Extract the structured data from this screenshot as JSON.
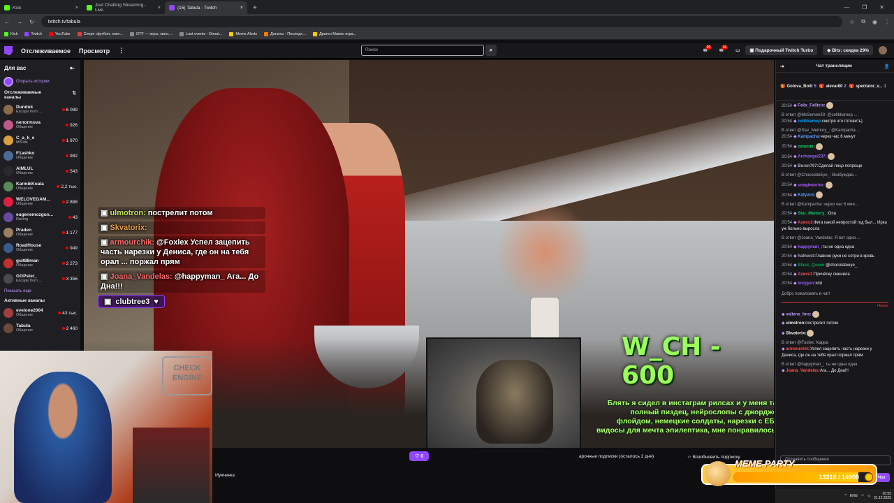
{
  "browser": {
    "tabs": [
      {
        "label": "Kick",
        "color": "#53fc18"
      },
      {
        "label": "Just Chatting Streaming - Live",
        "color": "#53fc18"
      },
      {
        "label": "(16) Tabula - Twitch",
        "color": "#9147ff"
      }
    ],
    "url": "twitch.tv/tabula",
    "bookmarks": [
      {
        "label": "Kick",
        "color": "#53fc18"
      },
      {
        "label": "Twitch",
        "color": "#9147ff"
      },
      {
        "label": "YouTube",
        "color": "#ff0000"
      },
      {
        "label": "Спорт: футбол, хоке...",
        "color": "#e04040"
      },
      {
        "label": "DTF — игры, кино,...",
        "color": "#888888"
      },
      {
        "label": "Last events - Donat...",
        "color": "#888888"
      },
      {
        "label": "Meme Alerts",
        "color": "#ffcc00"
      },
      {
        "label": "Донаты - Последн...",
        "color": "#ff7a00"
      },
      {
        "label": "Драгон Манис игра...",
        "color": "#ffcc00"
      }
    ]
  },
  "twitch": {
    "nav": {
      "following": "Отслеживаемое",
      "browse": "Просмотр",
      "search_placeholder": "Поиск",
      "notif_count": "29",
      "whisper_count": "16",
      "turbo": "Подарочный Twitch Turbo",
      "bits": "Bits: скидка 29%"
    },
    "sidebar": {
      "title": "Для вас",
      "stories": "Открыть истории",
      "followed_title": "Отслеживаемые каналы",
      "channels": [
        {
          "name": "Dunduk",
          "category": "Escape from ...",
          "viewers": "6 089",
          "color": "#8a6a4a"
        },
        {
          "name": "nenormova",
          "category": "Общение",
          "viewers": "926",
          "color": "#c05a8a"
        },
        {
          "name": "C_a_k_e",
          "category": "MiSide",
          "viewers": "1 870",
          "color": "#d8a040"
        },
        {
          "name": "F1ashko",
          "category": "Общение",
          "viewers": "982",
          "color": "#4a6a9a"
        },
        {
          "name": "AIMLUL",
          "category": "Общение",
          "viewers": "543",
          "color": "#2a2a2a"
        },
        {
          "name": "KarmikKoala",
          "category": "Общение",
          "viewers": "2,2 тыс.",
          "color": "#5a8a5a"
        },
        {
          "name": "WELOVEGAM...",
          "category": "Общение",
          "viewers": "2 888",
          "color": "#e02040"
        },
        {
          "name": "eugenemozgun...",
          "category": "Racing",
          "viewers": "43",
          "color": "#6a4aa0"
        },
        {
          "name": "Praden",
          "category": "Общение",
          "viewers": "1 177",
          "color": "#9a8060"
        },
        {
          "name": "RoadHouse",
          "category": "Общение",
          "viewers": "949",
          "color": "#3a5a8a"
        },
        {
          "name": "guit88man",
          "category": "Общение",
          "viewers": "2 273",
          "color": "#c03030"
        },
        {
          "name": "GOPster_",
          "category": "Escape from ...",
          "viewers": "3 356",
          "color": "#4a4a4a"
        }
      ],
      "show_more": "Показать еще",
      "active_title": "Активные каналы",
      "active": [
        {
          "name": "evelone2004",
          "category": "Общение",
          "viewers": "43 тыс.",
          "color": "#a04040"
        },
        {
          "name": "Tabula",
          "category": "Общение",
          "viewers": "2 460",
          "color": "#6a4a3a"
        }
      ]
    },
    "overlay_chat": [
      {
        "user": "ulmotron:",
        "text": "пострелит потом",
        "cls": "u-green"
      },
      {
        "user": "Skvatorix:",
        "text": "",
        "cls": "u-orange"
      },
      {
        "user": "armourchik:",
        "text": "@Foxlex Успел зацепить часть нарезки у Дениса, где он на тебя орал ... поржал прям",
        "cls": "u-red"
      },
      {
        "user": "Joana_Vandelas:",
        "text": "@happyman_ Ага... До Дна!!!",
        "cls": "u-red"
      }
    ],
    "club_label": "clubtree3",
    "wch_text": "W_CH - 600",
    "ticker": "Блять я сидел в инстаграм рилсах и у меня там полный пиздец, нейрослопы с джорджем флойдом, немецкие солдаты, нарезки с ЕБО, видосы для мечта эпилептика, мне понравилось...",
    "player": {
      "follow_label": "♡ 0",
      "sub_info": "арочные подписки (осталось 2 дня)",
      "renew": "Возобновить подписку",
      "category_tag": "Мужчинка"
    },
    "chat": {
      "title": "Чат трансляции",
      "gifters": [
        {
          "name": "Golova_Bolit",
          "count": "5"
        },
        {
          "name": "alevar80",
          "count": "2"
        },
        {
          "name": "spectator_v...",
          "count": "1"
        }
      ],
      "messages": [
        {
          "time": "20:54",
          "reply": "",
          "user": "Felix_Fellicis:",
          "color": "#bf94ff",
          "text": ""
        },
        {
          "time": "20:54",
          "reply": "В ответ @McSemen33: @cellbkamep ...",
          "user": "cellbkamep:",
          "color": "#00a0ff",
          "text": "смотря что готовить)"
        },
        {
          "time": "20:54",
          "reply": "В ответ @Star_Memory_: @Kampacha ...",
          "user": "Kampacha:",
          "color": "#5aa0ff",
          "text": "через час 6 минут"
        },
        {
          "time": "20:54",
          "reply": "",
          "user": "cemmik:",
          "color": "#00d060",
          "text": ""
        },
        {
          "time": "20:54",
          "reply": "",
          "user": "Archange/237:",
          "color": "#9a60ff",
          "text": ""
        },
        {
          "time": "20:54",
          "reply": "",
          "user": "Buran767:",
          "color": "#adadb8",
          "text": "Сделай лицо попроще"
        },
        {
          "time": "",
          "reply": "В ответ @ChocolateEye_: Возбуждае...",
          "user": "",
          "color": "#adadb8",
          "text": ""
        },
        {
          "time": "20:54",
          "reply": "",
          "user": "unagiwarrior:",
          "color": "#b05aff",
          "text": ""
        },
        {
          "time": "20:54",
          "reply": "",
          "user": "Kalyvus:",
          "color": "#5aa0ff",
          "text": ""
        },
        {
          "time": "",
          "reply": "В ответ @Kampacha: через час 6 мин...",
          "user": "",
          "color": "#adadb8",
          "text": ""
        },
        {
          "time": "20:54",
          "reply": "",
          "user": "Star_Memory_:",
          "color": "#00d060",
          "text": "Опа"
        },
        {
          "time": "20:54",
          "reply": "",
          "user": "Azexs1:",
          "color": "#ff5050",
          "text": "Фига какой непростой год был... Ирка уж больно выросла"
        },
        {
          "time": "",
          "reply": "В ответ @Joana_Vandelas: Я вот одна ...",
          "user": "",
          "color": "#adadb8",
          "text": ""
        },
        {
          "time": "20:54",
          "reply": "",
          "user": "happyman_:",
          "color": "#9a60ff",
          "text": "ты не одна одна"
        },
        {
          "time": "20:54",
          "reply": "",
          "user": "hatheist:",
          "color": "#adadb8",
          "text": "Главное руки не сотри в кровь"
        },
        {
          "time": "20:54",
          "reply": "",
          "user": "Black_Queen:",
          "color": "#00a050",
          "text": "@chocolateeye_"
        },
        {
          "time": "20:54",
          "reply": "",
          "user": "Azexs1:",
          "color": "#ff5050",
          "text": "Причёску сменила"
        },
        {
          "time": "20:54",
          "reply": "",
          "user": "lovygon:",
          "color": "#9a60ff",
          "text": "xdd"
        }
      ],
      "welcome": "Добро пожаловать в чат!",
      "new_label": "Новое",
      "new_messages": [
        {
          "reply": "",
          "user": "valiens_hns:",
          "color": "#bf94ff",
          "text": ""
        },
        {
          "reply": "",
          "user": "ulmotron:",
          "color": "#efeff1",
          "text": "пострелит потом"
        },
        {
          "reply": "",
          "user": "Skvatorix:",
          "color": "#efeff1",
          "text": ""
        },
        {
          "reply": "В ответ @Foxlex: Kappa",
          "user": "armourchik:",
          "color": "#ff5050",
          "text": "Успел зацепить часть нарезки у Дениса, где он на тебя орал поржал прям"
        },
        {
          "reply": "В ответ @happyman_: ты не одна одна",
          "user": "Joana_Vandelas:",
          "color": "#ff5050",
          "text": "Ага... До Дна!!!"
        }
      ],
      "input_placeholder": "Отправить сообщение",
      "send_label": "Чат"
    },
    "meme_party": {
      "title": "MEME PARTY",
      "current": "13318",
      "goal": "14900",
      "value_text": "13318 / 14900",
      "progress": 0.894
    }
  },
  "taskbar": {
    "lang": "ENG",
    "time": "20:55",
    "date": "31.12.2025"
  }
}
